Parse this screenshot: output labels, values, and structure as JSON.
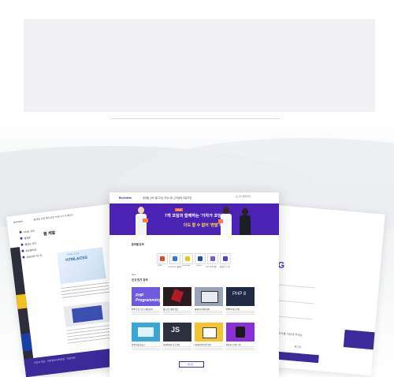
{
  "center_page": {
    "logo": "Bsolution",
    "nav": [
      "웹개발 강좌",
      "웹디자인",
      "커뮤니티",
      "고객센터",
      "회원가입"
    ],
    "util": "로그인 회원가입",
    "banner": {
      "badge": "2023",
      "headline": "7개 코딩과 함께하는 '가자가 코딩'",
      "subline": "더도 할 수 없어 '변말'치"
    },
    "section_categories": "분야별 강의",
    "categories": [
      {
        "label": "HTML",
        "color": "#e14b2a"
      },
      {
        "label": "CSS/HTML 웹표준",
        "color": "#2a7be1"
      },
      {
        "label": "JavaScript",
        "color": "#f2c21b"
      },
      {
        "label": "jQuery",
        "color": "#1b4fa8"
      },
      {
        "label": "PHP 서버 개발",
        "color": "#7b58d8"
      },
      {
        "label": "웹개발 로드맵",
        "color": "#5b3ad1"
      }
    ],
    "section_courses_kicker": "NEW",
    "section_courses": "신규 인기 강의",
    "courses": [
      {
        "title": "PHP Programming",
        "caption": "PHP 초보 프로그래밍 강좌",
        "color": "#6c5ae0"
      },
      {
        "title": "",
        "caption": "웹 프로그래밍 입문",
        "color": "#b11a26"
      },
      {
        "title": "",
        "caption": "홈페이지 제작 강좌",
        "color": "#9aa2b8"
      },
      {
        "title": "PHP 8",
        "caption": "PHP 8 최신 문법",
        "color": "#1f2a44"
      },
      {
        "title": "",
        "caption": "반응형 웹 만들기",
        "color": "#39a6d8"
      },
      {
        "title": "JS",
        "caption": "JavaScript 기초 강좌",
        "color": "#2c3140"
      },
      {
        "title": "",
        "caption": "Javascript 문법 입문",
        "color": "#f4c430"
      },
      {
        "title": "",
        "caption": "Figma 디자인 기초",
        "color": "#8b2fd6"
      }
    ],
    "more_button": "더보기"
  },
  "left_page": {
    "logo": "Bsolution",
    "nav": "웹개발 강좌 웹디자인 커뮤니티 고객센터",
    "title": "웹 개발",
    "menu": [
      "HTML 강좌",
      "웹표준",
      "웹접근 강의",
      "포트폴리오",
      "유료강좌 리스트"
    ],
    "book_title": "HTML&CSS",
    "book_label": "HTML+CSS",
    "footer_text": "사업자 정보 · 개인정보처리방침 · 이용약관"
  },
  "right_page": {
    "heading": "ING",
    "small_text": "회원가입 후 강의를 이용해 주세요",
    "label": "로그인"
  }
}
